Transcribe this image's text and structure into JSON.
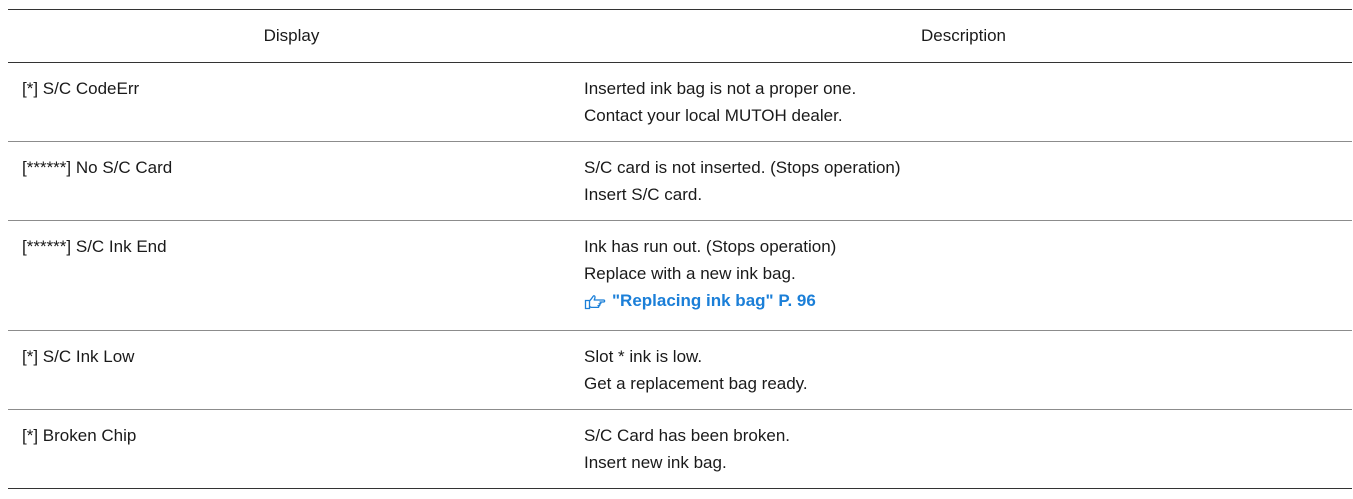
{
  "table": {
    "headers": {
      "display": "Display",
      "description": "Description"
    },
    "rows": [
      {
        "display": "[*] S/C CodeErr",
        "desc_1": "Inserted ink bag is not a proper one.",
        "desc_2": "Contact your local MUTOH dealer."
      },
      {
        "display": "[******] No S/C Card",
        "desc_1": "S/C card is not inserted. (Stops operation)",
        "desc_2": "Insert S/C card."
      },
      {
        "display": "[******] S/C Ink End",
        "desc_1": "Ink has run out. (Stops operation)",
        "desc_2": "Replace with a new ink bag.",
        "link_text": "\"Replacing ink bag\" P. 96",
        "link_icon": "pointing-hand-icon"
      },
      {
        "display": "[*] S/C Ink Low",
        "desc_1": "Slot * ink is low.",
        "desc_2": "Get a replacement bag ready."
      },
      {
        "display": "[*] Broken Chip",
        "desc_1": "S/C Card has been broken.",
        "desc_2": "Insert new ink bag."
      }
    ]
  },
  "colors": {
    "link": "#1b7fd8",
    "rule": "#333333",
    "row_divider": "#8c8c8c"
  }
}
